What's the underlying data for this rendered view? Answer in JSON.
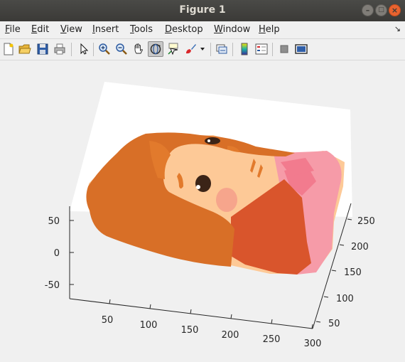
{
  "window": {
    "title": "Figure 1"
  },
  "menu": {
    "items": [
      {
        "mn": "F",
        "rest": "ile"
      },
      {
        "mn": "E",
        "rest": "dit"
      },
      {
        "mn": "V",
        "rest": "iew"
      },
      {
        "mn": "I",
        "rest": "nsert"
      },
      {
        "mn": "T",
        "rest": "ools"
      },
      {
        "mn": "D",
        "rest": "esktop"
      },
      {
        "mn": "W",
        "rest": "indow"
      },
      {
        "mn": "H",
        "rest": "elp"
      }
    ],
    "dock_glyph": "↘"
  },
  "toolbar": {
    "buttons": [
      "new-figure",
      "open-file",
      "save",
      "print",
      "edit-plot",
      "zoom-in",
      "zoom-out",
      "pan",
      "rotate-3d",
      "data-cursor",
      "brush",
      "brush-dropdown",
      "link-plot",
      "colorbar",
      "legend",
      "hide-plot-tools",
      "show-plot-tools"
    ],
    "active": "rotate-3d"
  },
  "chart_data": {
    "type": "surface",
    "y_axis_ticks": [
      "50",
      "100",
      "150",
      "200",
      "250",
      "300"
    ],
    "x_axis_ticks": [
      "50",
      "100",
      "150",
      "200",
      "250"
    ],
    "z_axis_ticks": [
      "50",
      "0",
      "-50"
    ],
    "colors": {
      "hair": "#d86f27",
      "hair_inner": "#e27a2c",
      "skin": "#fdc997",
      "cheek": "#f6a58c",
      "eye": "#3b2417",
      "shirt": "#d9552c",
      "collar": "#f69ba8",
      "collar_dark": "#f27b8e",
      "plane": "#ffffff"
    }
  }
}
